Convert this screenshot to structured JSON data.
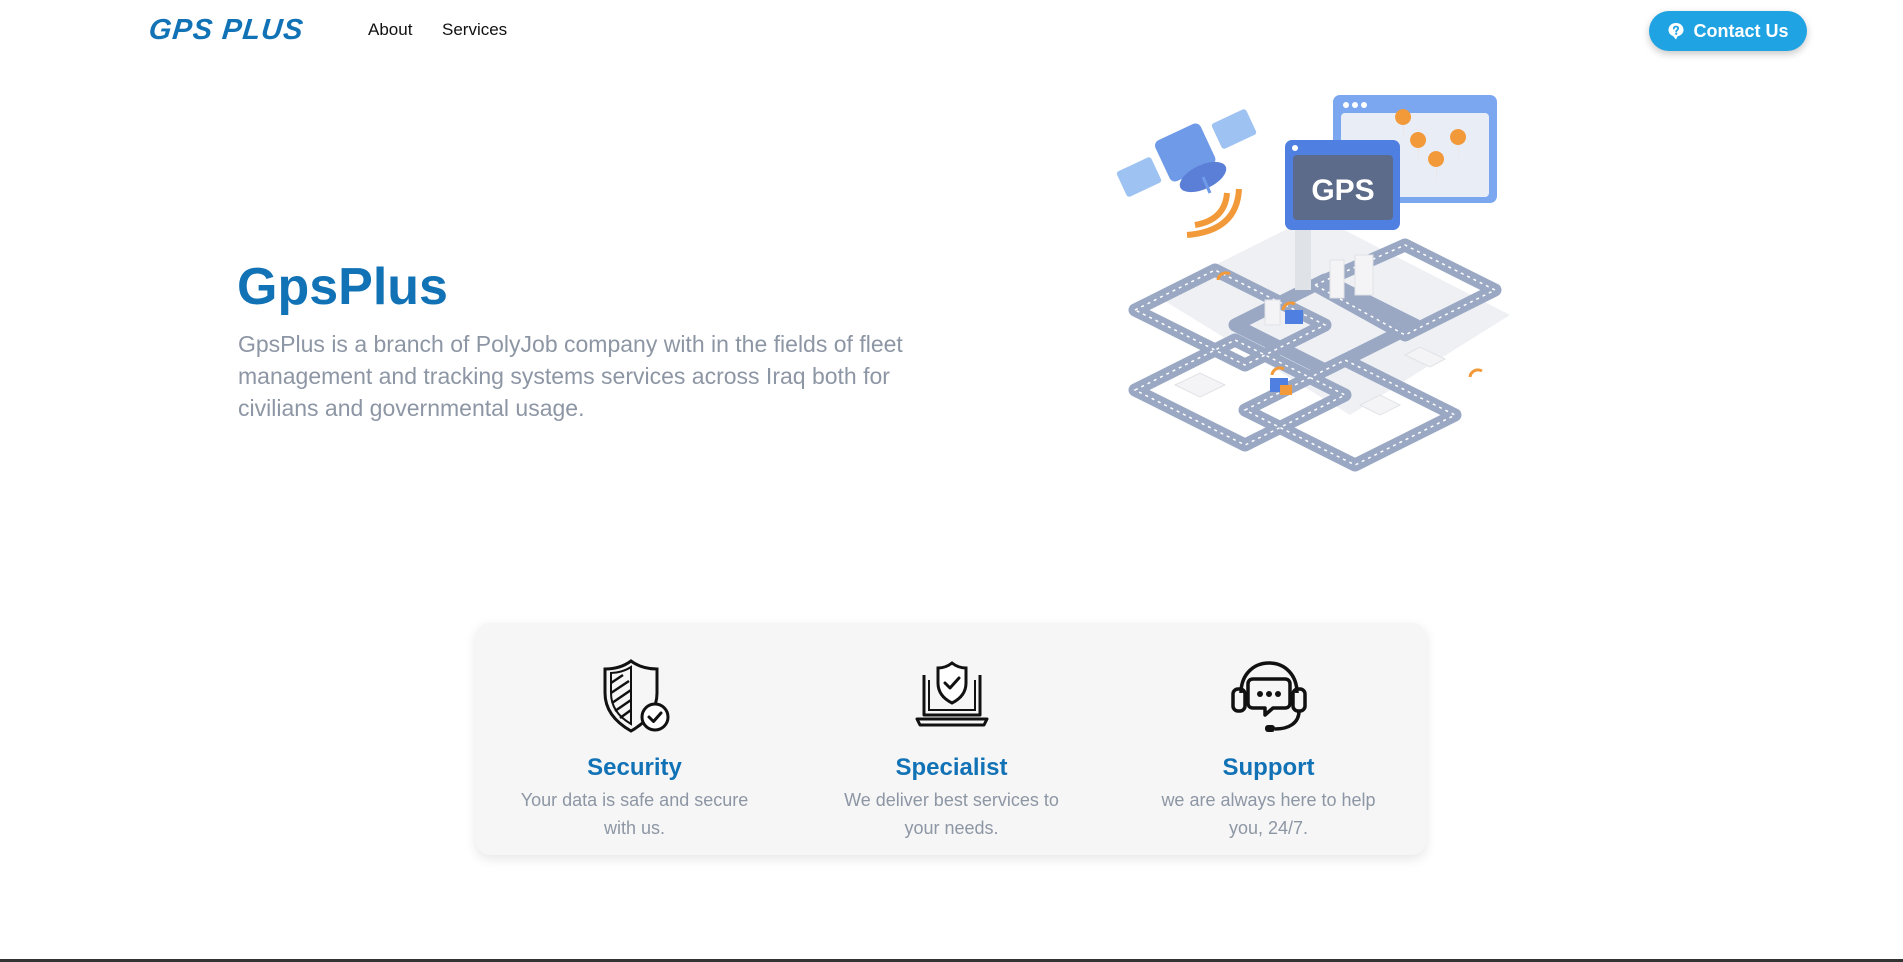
{
  "nav": {
    "logo_text": "GPS PLUS",
    "links": [
      {
        "label": "About"
      },
      {
        "label": "Services"
      }
    ],
    "contact_label": "Contact Us"
  },
  "hero": {
    "title": "GpsPlus",
    "description": "GpsPlus is a branch of PolyJob company with in the fields of fleet management and tracking systems services across Iraq both for civilians and governmental usage.",
    "illustration_label": "GPS"
  },
  "features": [
    {
      "icon": "shield-check-icon",
      "title": "Security",
      "description": "Your data is safe and secure with us."
    },
    {
      "icon": "laptop-shield-icon",
      "title": "Specialist",
      "description": "We deliver best services to your needs."
    },
    {
      "icon": "headset-chat-icon",
      "title": "Support",
      "description": "we are always here to help you, 24/7."
    }
  ],
  "colors": {
    "brand": "#1272b6",
    "button": "#1fa3e3",
    "muted_text": "#8d96a4",
    "card_bg": "#f6f6f6"
  }
}
